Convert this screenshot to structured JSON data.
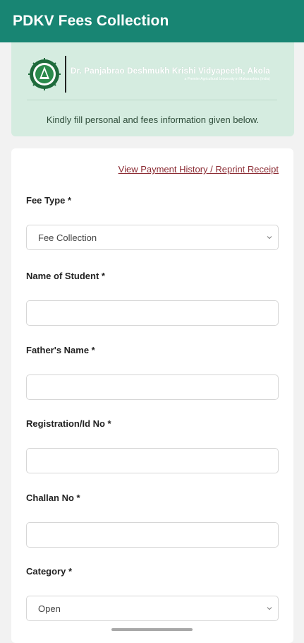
{
  "appbar": {
    "title": "PDKV Fees Collection"
  },
  "banner": {
    "institution_name": "Dr. Panjabrao Deshmukh Krishi Vidyapeeth, Akola",
    "institution_subtitle": "a Premier Agricultural University in Maharashtra (India)",
    "info_text": "Kindly fill personal and fees information given below."
  },
  "form": {
    "history_link": "View Payment History / Reprint Receipt",
    "fee_type": {
      "label": "Fee Type *",
      "value": "Fee Collection"
    },
    "student_name": {
      "label": "Name of Student *",
      "value": ""
    },
    "father_name": {
      "label": "Father's Name *",
      "value": ""
    },
    "registration_no": {
      "label": "Registration/Id No *",
      "value": ""
    },
    "challan_no": {
      "label": "Challan No *",
      "value": ""
    },
    "category": {
      "label": "Category *",
      "value": "Open"
    }
  },
  "colors": {
    "appbar": "#188573",
    "banner": "#d5ece0",
    "link": "#8b2b33"
  }
}
